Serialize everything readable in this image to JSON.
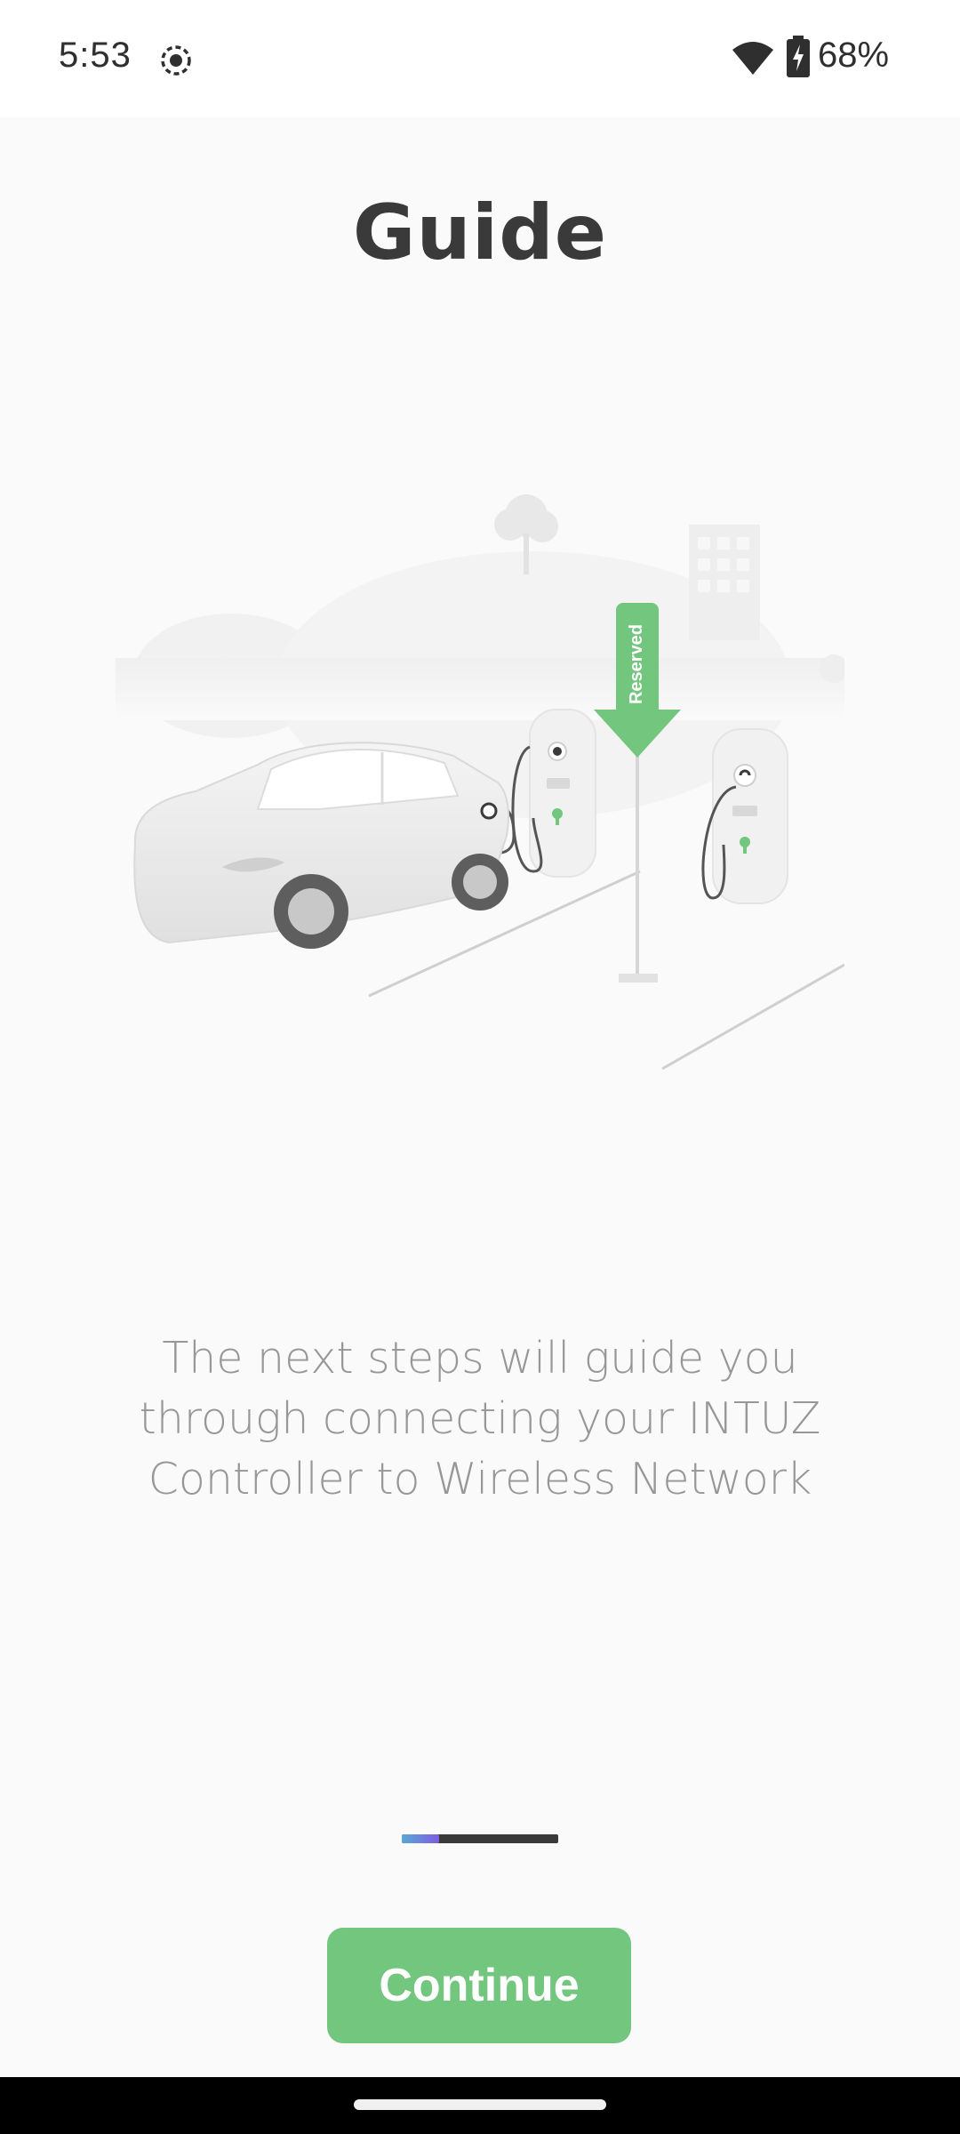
{
  "status_bar": {
    "time": "5:53",
    "battery": "68%",
    "icons": [
      "screen-record-icon",
      "wifi-icon",
      "battery-charging-icon"
    ]
  },
  "page": {
    "title": "Guide",
    "description": "The next steps will guide you through connecting your INTUZ Controller to Wireless Network",
    "illustration": {
      "sign_label": "Reserved"
    }
  },
  "pager": {
    "current_page": 1,
    "active_fraction": 0.24
  },
  "actions": {
    "continue_label": "Continue"
  },
  "colors": {
    "accent_green": "#73c67e",
    "title_text": "#3a3a3a",
    "body_text": "#979797",
    "background": "#fafafa"
  }
}
